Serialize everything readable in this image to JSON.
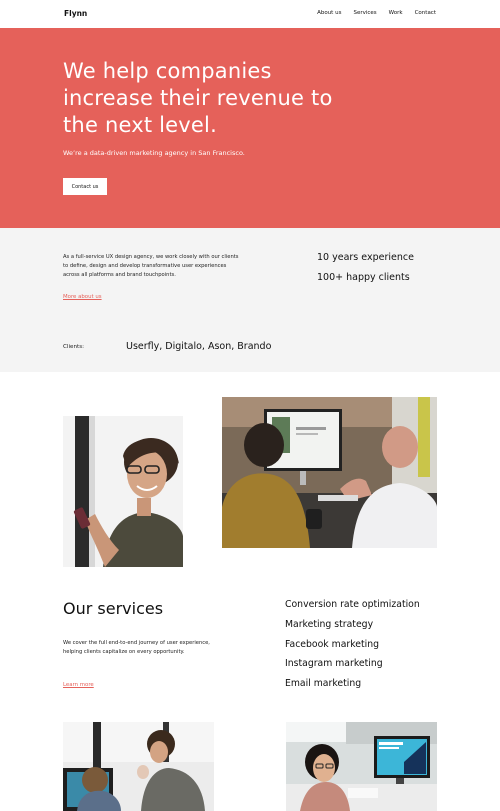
{
  "nav": {
    "logo": "Flynn",
    "links": [
      "About us",
      "Services",
      "Work",
      "Contact"
    ]
  },
  "hero": {
    "headline": "We help companies increase their revenue to the next level.",
    "subtitle": "We’re a data-driven marketing agency in San Francisco.",
    "cta_label": "Contact us",
    "background_color": "#e5615a"
  },
  "about": {
    "description": "As a full-service UX design agency, we work closely with our clients to define, design and develop transformative user experiences across all platforms and brand touchpoints.",
    "more_link": "More about us",
    "stats": [
      "10 years experience",
      "100+ happy clients"
    ],
    "clients_label": "Clients:",
    "clients_list": "Userfly, Digitalo, Ason, Brando"
  },
  "services": {
    "title": "Our services",
    "description": "We cover the full end-to-end journey of user experience, helping clients capitalize on every opportunity.",
    "more_link": "Learn more",
    "items": [
      "Conversion rate optimization",
      "Marketing strategy",
      "Facebook marketing",
      "Instagram marketing",
      "Email marketing"
    ]
  },
  "accent_color": "#e5615a"
}
